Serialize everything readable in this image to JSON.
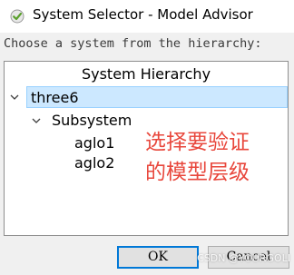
{
  "window": {
    "title": "System Selector - Model Advisor"
  },
  "prompt": "Choose a system from the hierarchy:",
  "tree": {
    "header": "System Hierarchy",
    "nodes": [
      {
        "label": "three6",
        "level": 0,
        "expanded": true,
        "selected": true
      },
      {
        "label": "Subsystem",
        "level": 1,
        "expanded": true,
        "selected": false
      },
      {
        "label": "aglo1",
        "level": 2,
        "selected": false
      },
      {
        "label": "aglo2",
        "level": 2,
        "selected": false
      }
    ]
  },
  "annotation": "选择要验证\n的模型层级",
  "buttons": {
    "ok": "OK",
    "cancel": "Cancel"
  },
  "watermark": "CSDN @YOURGOLI",
  "colors": {
    "selection_bg": "#cce8ff",
    "annotation": "#e8473c",
    "title_icon": "#5aa02c"
  },
  "icons": {
    "title": "checkmark-circle-icon",
    "expand": "chevron-down-icon"
  }
}
